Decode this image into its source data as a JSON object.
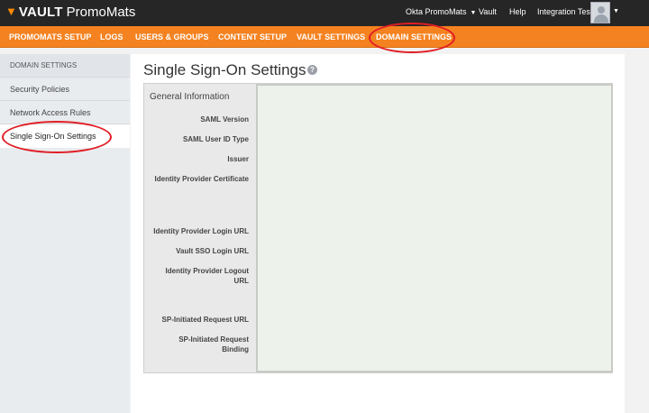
{
  "topbar": {
    "brand": "VAULT",
    "app": "PromoMats",
    "vault_menu": "Okta PromoMats",
    "vault_link": "Vault",
    "help_link": "Help",
    "user_name": "Integration Test"
  },
  "nav": {
    "items": [
      "PROMOMATS SETUP",
      "LOGS",
      "USERS & GROUPS",
      "CONTENT SETUP",
      "VAULT SETTINGS",
      "DOMAIN SETTINGS"
    ],
    "active": "DOMAIN SETTINGS"
  },
  "sidebar": {
    "header": "DOMAIN SETTINGS",
    "items": [
      "Security Policies",
      "Network Access Rules",
      "Single Sign-On Settings"
    ],
    "active": "Single Sign-On Settings"
  },
  "main": {
    "title": "Single Sign-On Settings",
    "section": "General Information",
    "fields": [
      "SAML Version",
      "SAML User ID Type",
      "Issuer",
      "Identity Provider Certificate",
      "Identity Provider Login URL",
      "Vault SSO Login URL",
      "Identity Provider Logout URL",
      "SP-Initiated Request URL",
      "SP-Initiated Request Binding"
    ]
  },
  "colors": {
    "topbar": "#262626",
    "nav_orange": "#f58220",
    "annotation_red": "#e11d24",
    "value_area": "#edf2ea"
  }
}
